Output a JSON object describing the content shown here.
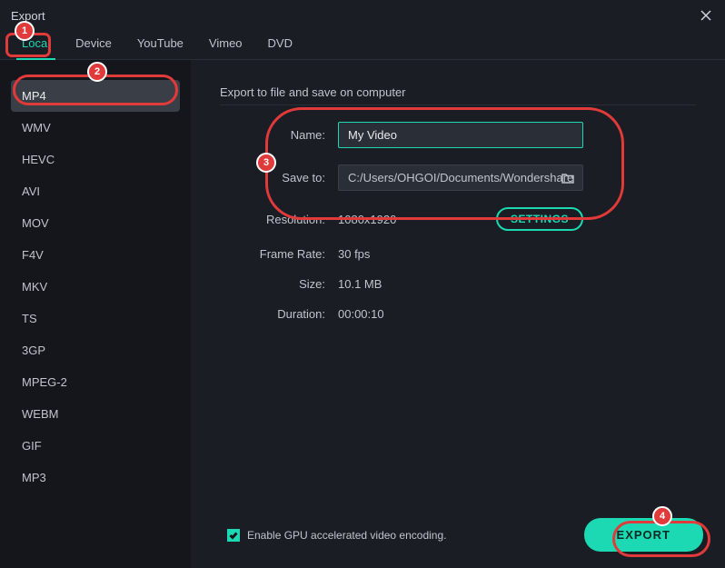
{
  "window": {
    "title": "Export"
  },
  "tabs": [
    "Local",
    "Device",
    "YouTube",
    "Vimeo",
    "DVD"
  ],
  "active_tab": "Local",
  "formats": [
    "MP4",
    "WMV",
    "HEVC",
    "AVI",
    "MOV",
    "F4V",
    "MKV",
    "TS",
    "3GP",
    "MPEG-2",
    "WEBM",
    "GIF",
    "MP3"
  ],
  "active_format": "MP4",
  "main": {
    "heading": "Export to file and save on computer",
    "labels": {
      "name": "Name:",
      "save_to": "Save to:",
      "resolution": "Resolution:",
      "frame_rate": "Frame Rate:",
      "size": "Size:",
      "duration": "Duration:"
    },
    "values": {
      "name": "My Video",
      "save_to": "C:/Users/OHGOI/Documents/Wondershare",
      "resolution": "1080x1920",
      "frame_rate": "30 fps",
      "size": "10.1 MB",
      "duration": "00:00:10"
    },
    "settings_button": "SETTINGS"
  },
  "footer": {
    "gpu_label": "Enable GPU accelerated video encoding.",
    "gpu_checked": true,
    "export_button": "EXPORT"
  },
  "annotations": {
    "b1": "1",
    "b2": "2",
    "b3": "3",
    "b4": "4"
  }
}
